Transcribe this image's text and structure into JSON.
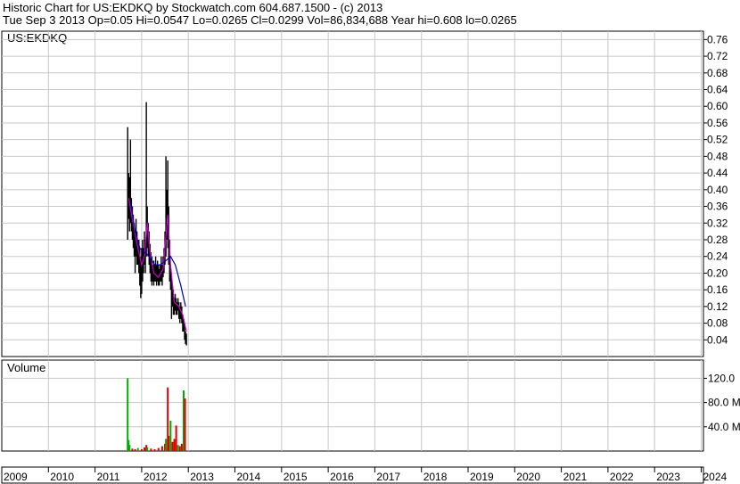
{
  "header": {
    "line1": "Historic Chart for US:EKDKQ by Stockwatch.com 604.687.1500 - (c) 2013",
    "line2": "Tue Sep  3 2013  Op=0.05  Hi=0.0547  Lo=0.0265  Cl=0.0299  Vol=86,834,688  Year hi=0.608  lo=0.0265"
  },
  "colors": {
    "background": "#ffffff",
    "grid": "#c8c8c8",
    "price": "#000000",
    "ma_short": "#cc00cc",
    "ma_long": "#0000aa",
    "vol_up": "#00aa00",
    "vol_down": "#dd0000"
  },
  "chart_data": [
    {
      "type": "line",
      "title": "US:EKDKQ",
      "x_range": [
        2009,
        2024
      ],
      "ylim": [
        0,
        0.78
      ],
      "y_ticks": [
        "0.76",
        "0.72",
        "0.68",
        "0.64",
        "0.60",
        "0.56",
        "0.52",
        "0.48",
        "0.44",
        "0.40",
        "0.36",
        "0.32",
        "0.28",
        "0.24",
        "0.20",
        "0.16",
        "0.12",
        "0.08",
        "0.04"
      ],
      "grid": true,
      "price_bars": [
        {
          "t": 2011.7,
          "hi": 0.55,
          "lo": 0.28
        },
        {
          "t": 2011.72,
          "hi": 0.44,
          "lo": 0.33
        },
        {
          "t": 2011.74,
          "hi": 0.43,
          "lo": 0.3
        },
        {
          "t": 2011.76,
          "hi": 0.52,
          "lo": 0.32
        },
        {
          "t": 2011.78,
          "hi": 0.38,
          "lo": 0.3
        },
        {
          "t": 2011.8,
          "hi": 0.36,
          "lo": 0.28
        },
        {
          "t": 2011.82,
          "hi": 0.34,
          "lo": 0.26
        },
        {
          "t": 2011.84,
          "hi": 0.32,
          "lo": 0.24
        },
        {
          "t": 2011.86,
          "hi": 0.3,
          "lo": 0.2
        },
        {
          "t": 2011.88,
          "hi": 0.33,
          "lo": 0.24
        },
        {
          "t": 2011.9,
          "hi": 0.3,
          "lo": 0.22
        },
        {
          "t": 2011.92,
          "hi": 0.28,
          "lo": 0.22
        },
        {
          "t": 2011.94,
          "hi": 0.28,
          "lo": 0.2
        },
        {
          "t": 2011.96,
          "hi": 0.26,
          "lo": 0.17
        },
        {
          "t": 2011.98,
          "hi": 0.24,
          "lo": 0.14
        },
        {
          "t": 2012.0,
          "hi": 0.26,
          "lo": 0.15
        },
        {
          "t": 2012.02,
          "hi": 0.28,
          "lo": 0.18
        },
        {
          "t": 2012.04,
          "hi": 0.26,
          "lo": 0.2
        },
        {
          "t": 2012.06,
          "hi": 0.3,
          "lo": 0.22
        },
        {
          "t": 2012.08,
          "hi": 0.28,
          "lo": 0.2
        },
        {
          "t": 2012.1,
          "hi": 0.61,
          "lo": 0.24
        },
        {
          "t": 2012.12,
          "hi": 0.36,
          "lo": 0.26
        },
        {
          "t": 2012.14,
          "hi": 0.32,
          "lo": 0.24
        },
        {
          "t": 2012.16,
          "hi": 0.3,
          "lo": 0.22
        },
        {
          "t": 2012.18,
          "hi": 0.27,
          "lo": 0.2
        },
        {
          "t": 2012.2,
          "hi": 0.25,
          "lo": 0.18
        },
        {
          "t": 2012.22,
          "hi": 0.24,
          "lo": 0.17
        },
        {
          "t": 2012.24,
          "hi": 0.22,
          "lo": 0.18
        },
        {
          "t": 2012.26,
          "hi": 0.23,
          "lo": 0.17
        },
        {
          "t": 2012.28,
          "hi": 0.22,
          "lo": 0.18
        },
        {
          "t": 2012.3,
          "hi": 0.24,
          "lo": 0.18
        },
        {
          "t": 2012.32,
          "hi": 0.22,
          "lo": 0.17
        },
        {
          "t": 2012.34,
          "hi": 0.23,
          "lo": 0.18
        },
        {
          "t": 2012.36,
          "hi": 0.22,
          "lo": 0.17
        },
        {
          "t": 2012.38,
          "hi": 0.21,
          "lo": 0.17
        },
        {
          "t": 2012.4,
          "hi": 0.22,
          "lo": 0.18
        },
        {
          "t": 2012.42,
          "hi": 0.24,
          "lo": 0.18
        },
        {
          "t": 2012.44,
          "hi": 0.22,
          "lo": 0.17
        },
        {
          "t": 2012.46,
          "hi": 0.24,
          "lo": 0.19
        },
        {
          "t": 2012.48,
          "hi": 0.26,
          "lo": 0.2
        },
        {
          "t": 2012.5,
          "hi": 0.3,
          "lo": 0.22
        },
        {
          "t": 2012.52,
          "hi": 0.48,
          "lo": 0.24
        },
        {
          "t": 2012.54,
          "hi": 0.4,
          "lo": 0.28
        },
        {
          "t": 2012.56,
          "hi": 0.47,
          "lo": 0.26
        },
        {
          "t": 2012.58,
          "hi": 0.36,
          "lo": 0.22
        },
        {
          "t": 2012.6,
          "hi": 0.28,
          "lo": 0.18
        },
        {
          "t": 2012.62,
          "hi": 0.22,
          "lo": 0.16
        },
        {
          "t": 2012.64,
          "hi": 0.2,
          "lo": 0.09
        },
        {
          "t": 2012.66,
          "hi": 0.17,
          "lo": 0.12
        },
        {
          "t": 2012.68,
          "hi": 0.16,
          "lo": 0.1
        },
        {
          "t": 2012.7,
          "hi": 0.14,
          "lo": 0.1
        },
        {
          "t": 2012.72,
          "hi": 0.15,
          "lo": 0.11
        },
        {
          "t": 2012.74,
          "hi": 0.14,
          "lo": 0.1
        },
        {
          "t": 2012.76,
          "hi": 0.13,
          "lo": 0.1
        },
        {
          "t": 2012.78,
          "hi": 0.14,
          "lo": 0.11
        },
        {
          "t": 2012.8,
          "hi": 0.13,
          "lo": 0.09
        },
        {
          "t": 2012.82,
          "hi": 0.12,
          "lo": 0.08
        },
        {
          "t": 2012.84,
          "hi": 0.13,
          "lo": 0.09
        },
        {
          "t": 2012.86,
          "hi": 0.12,
          "lo": 0.08
        },
        {
          "t": 2012.88,
          "hi": 0.1,
          "lo": 0.06
        },
        {
          "t": 2012.9,
          "hi": 0.09,
          "lo": 0.06
        },
        {
          "t": 2012.92,
          "hi": 0.08,
          "lo": 0.04
        },
        {
          "t": 2012.94,
          "hi": 0.06,
          "lo": 0.03
        },
        {
          "t": 2012.96,
          "hi": 0.055,
          "lo": 0.0265
        }
      ],
      "ma_short": [
        {
          "t": 2011.72,
          "v": 0.38
        },
        {
          "t": 2011.8,
          "v": 0.33
        },
        {
          "t": 2011.9,
          "v": 0.27
        },
        {
          "t": 2012.0,
          "v": 0.22
        },
        {
          "t": 2012.06,
          "v": 0.24
        },
        {
          "t": 2012.12,
          "v": 0.32
        },
        {
          "t": 2012.18,
          "v": 0.25
        },
        {
          "t": 2012.26,
          "v": 0.2
        },
        {
          "t": 2012.36,
          "v": 0.19
        },
        {
          "t": 2012.46,
          "v": 0.21
        },
        {
          "t": 2012.52,
          "v": 0.29
        },
        {
          "t": 2012.56,
          "v": 0.34
        },
        {
          "t": 2012.62,
          "v": 0.22
        },
        {
          "t": 2012.7,
          "v": 0.13
        },
        {
          "t": 2012.8,
          "v": 0.12
        },
        {
          "t": 2012.88,
          "v": 0.1
        },
        {
          "t": 2012.96,
          "v": 0.06
        }
      ],
      "ma_long": [
        {
          "t": 2011.76,
          "v": 0.37
        },
        {
          "t": 2011.86,
          "v": 0.3
        },
        {
          "t": 2011.96,
          "v": 0.26
        },
        {
          "t": 2012.06,
          "v": 0.25
        },
        {
          "t": 2012.16,
          "v": 0.24
        },
        {
          "t": 2012.28,
          "v": 0.22
        },
        {
          "t": 2012.4,
          "v": 0.22
        },
        {
          "t": 2012.52,
          "v": 0.23
        },
        {
          "t": 2012.62,
          "v": 0.24
        },
        {
          "t": 2012.72,
          "v": 0.22
        },
        {
          "t": 2012.84,
          "v": 0.17
        },
        {
          "t": 2012.94,
          "v": 0.12
        }
      ]
    },
    {
      "type": "bar",
      "title": "Volume",
      "ylim": [
        0,
        150
      ],
      "y_ticks": [
        "120.0",
        "80.0 M",
        "40.0 M"
      ],
      "bars": [
        {
          "t": 2011.7,
          "v": 120,
          "up": true
        },
        {
          "t": 2011.72,
          "v": 18,
          "up": true
        },
        {
          "t": 2011.74,
          "v": 10,
          "up": true
        },
        {
          "t": 2011.8,
          "v": 4,
          "up": false
        },
        {
          "t": 2011.86,
          "v": 3,
          "up": false
        },
        {
          "t": 2011.92,
          "v": 5,
          "up": true
        },
        {
          "t": 2012.0,
          "v": 3,
          "up": false
        },
        {
          "t": 2012.06,
          "v": 6,
          "up": false
        },
        {
          "t": 2012.1,
          "v": 10,
          "up": false
        },
        {
          "t": 2012.12,
          "v": 6,
          "up": true
        },
        {
          "t": 2012.2,
          "v": 4,
          "up": false
        },
        {
          "t": 2012.28,
          "v": 3,
          "up": false
        },
        {
          "t": 2012.36,
          "v": 5,
          "up": false
        },
        {
          "t": 2012.44,
          "v": 8,
          "up": false
        },
        {
          "t": 2012.5,
          "v": 12,
          "up": false
        },
        {
          "t": 2012.52,
          "v": 20,
          "up": true
        },
        {
          "t": 2012.56,
          "v": 105,
          "up": false
        },
        {
          "t": 2012.58,
          "v": 25,
          "up": false
        },
        {
          "t": 2012.62,
          "v": 50,
          "up": true
        },
        {
          "t": 2012.66,
          "v": 15,
          "up": false
        },
        {
          "t": 2012.7,
          "v": 20,
          "up": false
        },
        {
          "t": 2012.74,
          "v": 42,
          "up": false
        },
        {
          "t": 2012.78,
          "v": 10,
          "up": true
        },
        {
          "t": 2012.82,
          "v": 8,
          "up": false
        },
        {
          "t": 2012.86,
          "v": 12,
          "up": false
        },
        {
          "t": 2012.9,
          "v": 100,
          "up": true
        },
        {
          "t": 2012.93,
          "v": 86.8,
          "up": false
        }
      ]
    }
  ],
  "x_axis": {
    "labels": [
      "2009",
      "2010",
      "2011",
      "2012",
      "2013",
      "2014",
      "2015",
      "2016",
      "2017",
      "2018",
      "2019",
      "2020",
      "2021",
      "2022",
      "2023",
      "2024"
    ]
  }
}
